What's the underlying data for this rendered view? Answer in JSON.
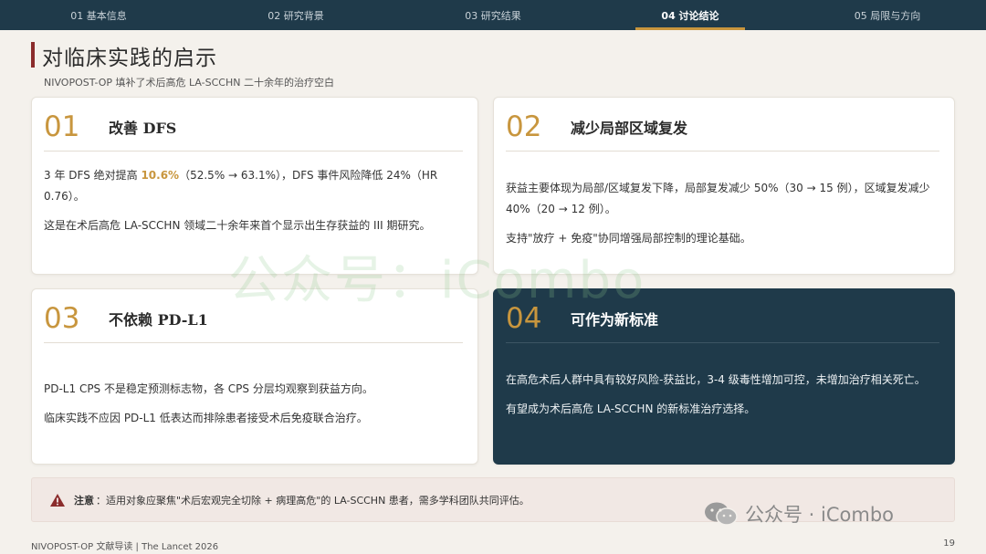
{
  "nav": {
    "tabs": [
      {
        "label": "01 基本信息",
        "active": false
      },
      {
        "label": "02 研究背景",
        "active": false
      },
      {
        "label": "03 研究结果",
        "active": false
      },
      {
        "label": "04 讨论结论",
        "active": true
      },
      {
        "label": "05 局限与方向",
        "active": false
      }
    ]
  },
  "header": {
    "title": "对临床实践的启示",
    "subtitle": "NIVOPOST-OP 填补了术后高危 LA-SCCHN 二十余年的治疗空白"
  },
  "cards": [
    {
      "num": "01",
      "title": "改善 DFS",
      "p1_pre": "3 年 DFS 绝对提高 ",
      "p1_hl": "10.6%",
      "p1_post": "（52.5% → 63.1%），DFS 事件风险降低 24%（HR 0.76）。",
      "p2": "这是在术后高危 LA-SCCHN 领域二十余年来首个显示出生存获益的 III 期研究。"
    },
    {
      "num": "02",
      "title": "减少局部区域复发",
      "p1": "获益主要体现为局部/区域复发下降，局部复发减少 50%（30 → 15 例），区域复发减少 40%（20 → 12 例）。",
      "p2": "支持\"放疗 + 免疫\"协同增强局部控制的理论基础。"
    },
    {
      "num": "03",
      "title": "不依赖 PD-L1",
      "p1": "PD-L1 CPS 不是稳定预测标志物，各 CPS 分层均观察到获益方向。",
      "p2": "临床实践不应因 PD-L1 低表达而排除患者接受术后免疫联合治疗。"
    },
    {
      "num": "04",
      "title": "可作为新标准",
      "p1": "在高危术后人群中具有较好风险-获益比，3-4 级毒性增加可控，未增加治疗相关死亡。",
      "p2": "有望成为术后高危 LA-SCCHN 的新标准治疗选择。"
    }
  ],
  "note": {
    "label": "注意",
    "text": "：适用对象应聚焦\"术后宏观完全切除 + 病理高危\"的 LA-SCCHN 患者，需多学科团队共同评估。"
  },
  "footer": {
    "left": "NIVOPOST-OP 文献导读 | The Lancet 2026",
    "page": "19"
  },
  "watermark": {
    "center": "公众号：iCombo",
    "corner": "公众号 · iCombo"
  },
  "colors": {
    "nav_bg": "#1f3a4a",
    "accent_gold": "#c8963e",
    "title_bar": "#8b2c2c",
    "dark_card": "#1f3a4a"
  }
}
